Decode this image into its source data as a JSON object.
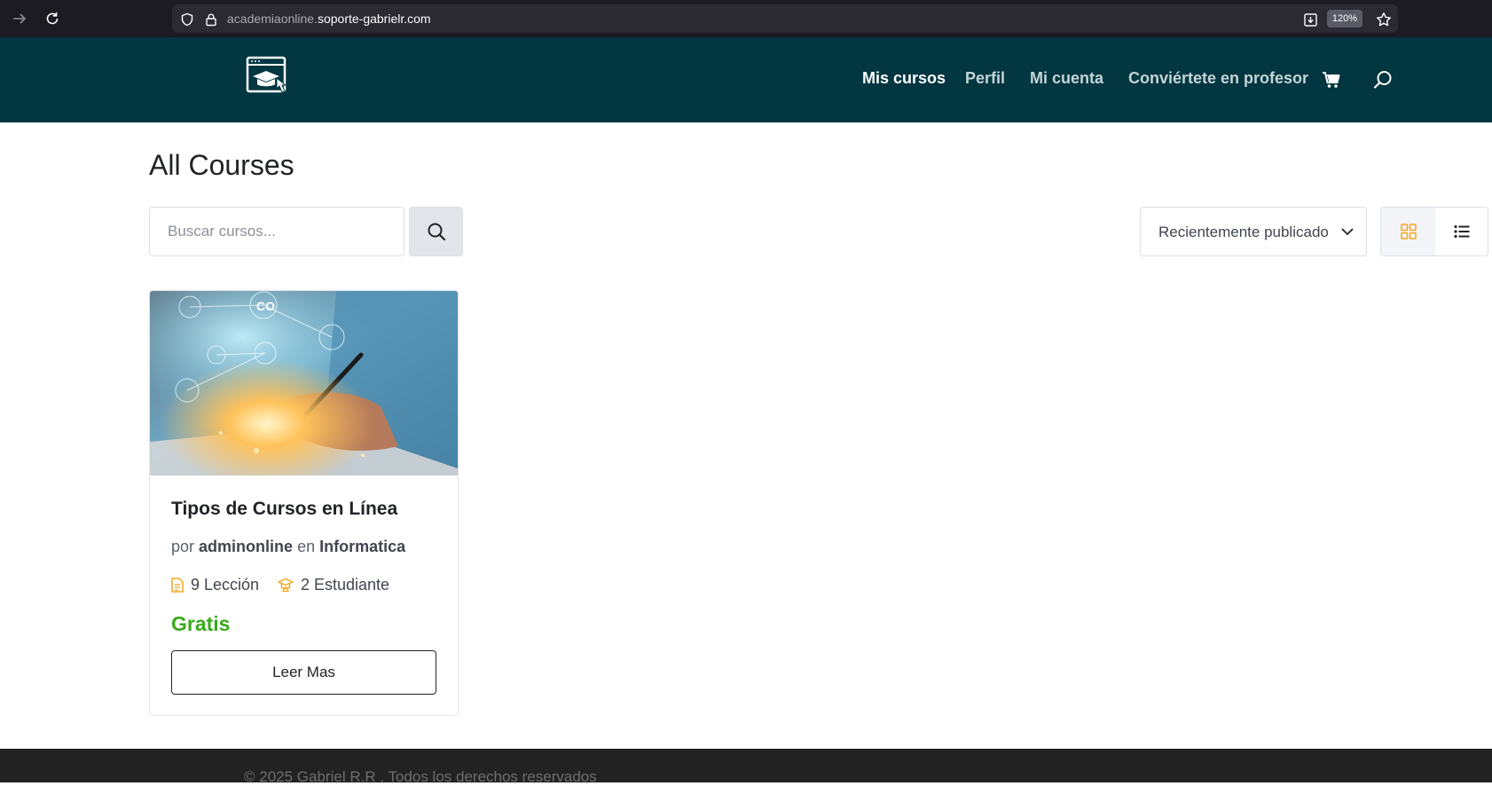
{
  "browser": {
    "url_host_prefix": "academiaonline.",
    "url_host_main": "soporte-gabrielr.com",
    "zoom": "120%"
  },
  "header": {
    "nav": [
      {
        "label": "Mis cursos",
        "active": true
      },
      {
        "label": "Perfil"
      },
      {
        "label": "Mi cuenta"
      },
      {
        "label": "Conviértete en profesor"
      }
    ]
  },
  "main": {
    "title": "All Courses",
    "search_placeholder": "Buscar cursos...",
    "sort_label": "Recientemente publicado"
  },
  "course": {
    "title": "Tipos de Cursos en Línea",
    "by": "por",
    "author": "adminonline",
    "in": "en",
    "category": "Informatica",
    "lessons": "9 Lección",
    "students": "2 Estudiante",
    "price": "Gratis",
    "button": "Leer Mas"
  },
  "footer": {
    "text": "© 2025 Gabriel R.R . Todos los derechos reservados"
  },
  "colors": {
    "header_bg": "#023640",
    "accent_icon": "#f5a623",
    "price": "#3aaa1d"
  }
}
